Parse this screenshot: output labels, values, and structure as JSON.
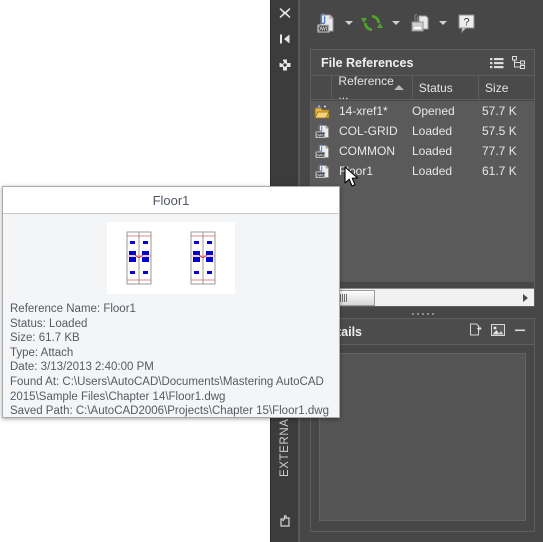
{
  "palette": {
    "vertical_label": "EXTERNAL REFERE",
    "rail_icons": [
      "close-icon",
      "auto-hide-icon",
      "panel-properties-icon"
    ],
    "bottom_icon": "pan-hand-icon"
  },
  "toolbar": {
    "buttons": [
      {
        "name": "attach-dwg-button",
        "icon": "attach-dwg-icon",
        "dropdown": true
      },
      {
        "name": "refresh-button",
        "icon": "refresh-icon",
        "dropdown": true
      },
      {
        "name": "change-path-button",
        "icon": "change-path-icon",
        "dropdown": true
      },
      {
        "name": "help-button",
        "icon": "help-question-icon",
        "dropdown": false
      }
    ]
  },
  "file_references": {
    "title": "File References",
    "view_icons": [
      "list-view-icon",
      "tree-view-icon"
    ],
    "columns": [
      {
        "label": "Reference ...",
        "sorted": true
      },
      {
        "label": "Status"
      },
      {
        "label": "Size"
      }
    ],
    "rows": [
      {
        "icon": "current-drawing-icon",
        "name": "14-xref1*",
        "status": "Opened",
        "size": "57.7 K"
      },
      {
        "icon": "dwg-xref-icon",
        "name": "COL-GRID",
        "status": "Loaded",
        "size": "57.5 K"
      },
      {
        "icon": "dwg-xref-icon",
        "name": "COMMON",
        "status": "Loaded",
        "size": "77.7 K"
      },
      {
        "icon": "dwg-xref-icon",
        "name": "Floor1",
        "status": "Loaded",
        "size": "61.7 K"
      }
    ]
  },
  "details_panel": {
    "title": "Details",
    "icons": [
      "details-view-icon",
      "preview-view-icon",
      "minimize-icon"
    ]
  },
  "tooltip": {
    "title": "Floor1",
    "lines": [
      "Reference Name: Floor1",
      "Status: Loaded",
      "Size: 61.7 KB",
      "Type: Attach",
      "Date: 3/13/2013 2:40:00 PM",
      "Found At: C:\\Users\\AutoCAD\\Documents\\Mastering AutoCAD 2015\\Sample Files\\Chapter 14\\Floor1.dwg",
      "Saved Path: C:\\AutoCAD2006\\Projects\\Chapter 15\\Floor1.dwg"
    ]
  },
  "colors": {
    "palette_bg": "#474747",
    "rail_bg": "#3c3c3c",
    "list_bg": "#5a5a5a",
    "header_bg": "#4c4c4c",
    "text": "#e8e8e8",
    "tooltip_bg": "#f4f5f7",
    "tooltip_text": "#555b63",
    "refresh_green": "#4fa52a",
    "drawing_blue": "#0000d0",
    "drawing_red": "#d03030"
  }
}
